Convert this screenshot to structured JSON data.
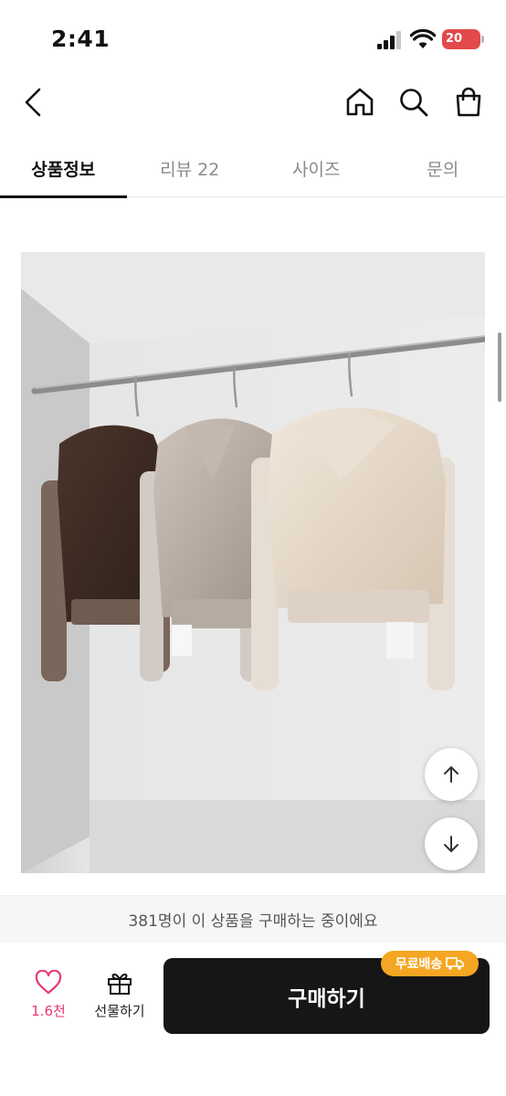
{
  "status_bar": {
    "time": "2:41",
    "battery": "20"
  },
  "nav": {
    "back_icon": "chevron-left-icon",
    "home_icon": "home-icon",
    "search_icon": "search-icon",
    "cart_icon": "shopping-bag-icon"
  },
  "tabs": [
    {
      "label": "상품정보",
      "active": true
    },
    {
      "label": "리뷰 22",
      "active": false
    },
    {
      "label": "사이즈",
      "active": false
    },
    {
      "label": "문의",
      "active": false
    }
  ],
  "product": {
    "image_colors": [
      "#3b2a22",
      "#b9aca2",
      "#e8dccd"
    ]
  },
  "floating": {
    "up_icon": "arrow-up-icon",
    "down_icon": "arrow-down-icon"
  },
  "buyer_banner": "381명이 이 상품을 구매하는 중이에요",
  "bottom_bar": {
    "like_count": "1.6천",
    "gift_label": "선물하기",
    "buy_label": "구매하기",
    "shipping_badge": "무료배송",
    "accent_color": "#e83a6e",
    "badge_color": "#f5a623"
  }
}
